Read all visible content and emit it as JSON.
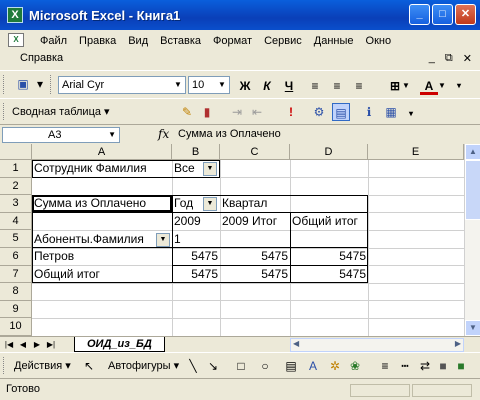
{
  "window": {
    "title": "Microsoft Excel - Книга1",
    "app_icon": "X"
  },
  "menu": {
    "items": [
      "Файл",
      "Правка",
      "Вид",
      "Вставка",
      "Формат",
      "Сервис",
      "Данные",
      "Окно"
    ],
    "help": "Справка"
  },
  "toolbar": {
    "font_name": "Arial Cyr",
    "font_size": "10",
    "bold": "Ж",
    "italic": "К",
    "underline": "Ч",
    "font_color_letter": "A",
    "accent_color": "#cc0000"
  },
  "pivot_toolbar": {
    "label": "Сводная таблица"
  },
  "formula_bar": {
    "cell_ref": "A3",
    "fx": "fx",
    "content": "Сумма из Оплачено"
  },
  "columns": [
    "A",
    "B",
    "C",
    "D",
    "E"
  ],
  "rows": [
    "1",
    "2",
    "3",
    "4",
    "5",
    "6",
    "7",
    "8",
    "9",
    "10"
  ],
  "cells": {
    "a1": "Сотрудник Фамилия",
    "b1": "Все",
    "a3": "Сумма из Оплачено",
    "b3": "Год",
    "c3": "Квартал",
    "b4": "2009",
    "c4": "2009 Итог",
    "d4": "Общий итог",
    "a5": "Абоненты.Фамилия",
    "b5": "1",
    "a6": "Петров",
    "b6": "5475",
    "c6": "5475",
    "d6": "5475",
    "a7": "Общий итог",
    "b7": "5475",
    "c7": "5475",
    "d7": "5475"
  },
  "sheet_tab": "ОИД_из_БД",
  "draw_toolbar": {
    "actions": "Действия",
    "autoshapes": "Автофигуры"
  },
  "status": "Готово"
}
